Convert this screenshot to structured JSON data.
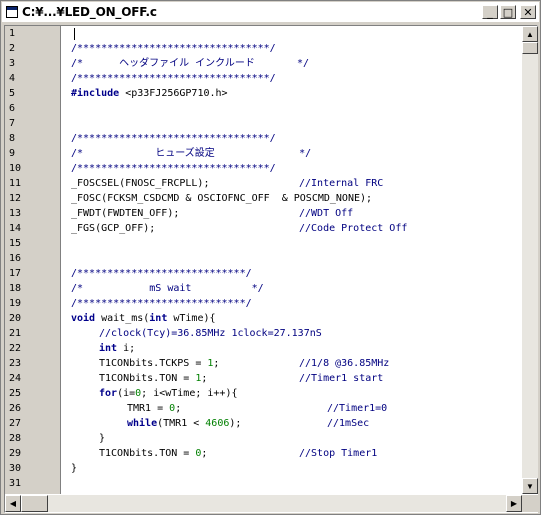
{
  "window": {
    "title": "C:¥...¥LED_ON_OFF.c",
    "minimize_glyph": "_",
    "maximize_glyph": "□",
    "close_glyph": "✕"
  },
  "scrollbar": {
    "up": "▲",
    "down": "▼",
    "left": "◀",
    "right": "▶"
  },
  "lines": [
    "1",
    "2",
    "3",
    "4",
    "5",
    "6",
    "7",
    "8",
    "9",
    "10",
    "11",
    "12",
    "13",
    "14",
    "15",
    "16",
    "17",
    "18",
    "19",
    "20",
    "21",
    "22",
    "23",
    "24",
    "25",
    "26",
    "27",
    "28",
    "29",
    "30",
    "31"
  ],
  "code": {
    "l2": "/********************************/",
    "l3": "/*      ヘッダファイル インクルード       */",
    "l4": "/********************************/",
    "l5_kw": "#include",
    "l5_rest": " <p33FJ256GP710.h>",
    "l8": "/********************************/",
    "l9": "/*            ヒューズ設定              */",
    "l10": "/********************************/",
    "l11_code": "_FOSCSEL(FNOSC_FRCPLL);",
    "l11_cmt": "//Internal FRC",
    "l12_code": "_FOSC(FCKSM_CSDCMD & OSCIOFNC_OFF  & POSCMD_NONE);",
    "l13_code": "_FWDT(FWDTEN_OFF);",
    "l13_cmt": "//WDT Off",
    "l14_code": "_FGS(GCP_OFF);",
    "l14_cmt": "//Code Protect Off",
    "l17": "/****************************/",
    "l18": "/*           mS wait          */",
    "l19": "/****************************/",
    "l20_kw1": "void",
    "l20_mid": " wait_ms(",
    "l20_kw2": "int",
    "l20_end": " wTime){",
    "l21": "//clock(Tcy)=36.85MHz 1clock=27.137nS",
    "l22_kw": "int",
    "l22_rest": " i;",
    "l23_code": "T1CONbits.TCKPS = ",
    "l23_num": "1",
    "l23_semi": ";",
    "l23_cmt": "//1/8 @36.85MHz",
    "l24_code": "T1CONbits.TON = ",
    "l24_num": "1",
    "l24_semi": ";",
    "l24_cmt": "//Timer1 start",
    "l25_kw": "for",
    "l25_a": "(i=",
    "l25_n1": "0",
    "l25_b": "; i<wTime; i++){",
    "l26_code": "TMR1 = ",
    "l26_num": "0",
    "l26_semi": ";",
    "l26_cmt": "//Timer1=0",
    "l27_kw": "while",
    "l27_a": "(TMR1 < ",
    "l27_num": "4606",
    "l27_b": ");",
    "l27_cmt": "//1mSec",
    "l28": "}",
    "l29_code": "T1CONbits.TON = ",
    "l29_num": "0",
    "l29_semi": ";",
    "l29_cmt": "//Stop Timer1",
    "l30": "}"
  },
  "colors": {
    "comment": "#000080",
    "keyword": "#00008b",
    "number": "#008000"
  }
}
